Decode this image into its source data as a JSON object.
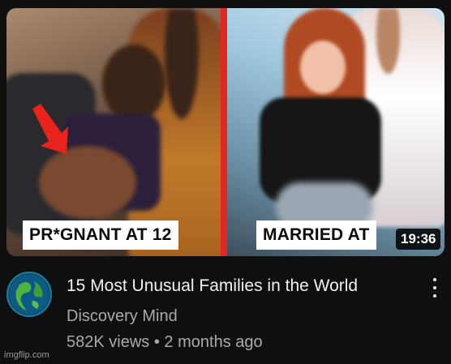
{
  "video": {
    "thumbnail": {
      "left_caption": "PR*GNANT AT 12",
      "right_caption": "MARRIED AT",
      "duration": "19:36",
      "accent_color": "#e42621"
    },
    "title": "15 Most Unusual Families in the World",
    "channel": "Discovery Mind",
    "views": "582K views",
    "separator": "•",
    "age": "2 months ago",
    "menu_icon": "more-vert-icon",
    "avatar_icon": "globe-icon"
  },
  "watermark": "imgflip.com"
}
